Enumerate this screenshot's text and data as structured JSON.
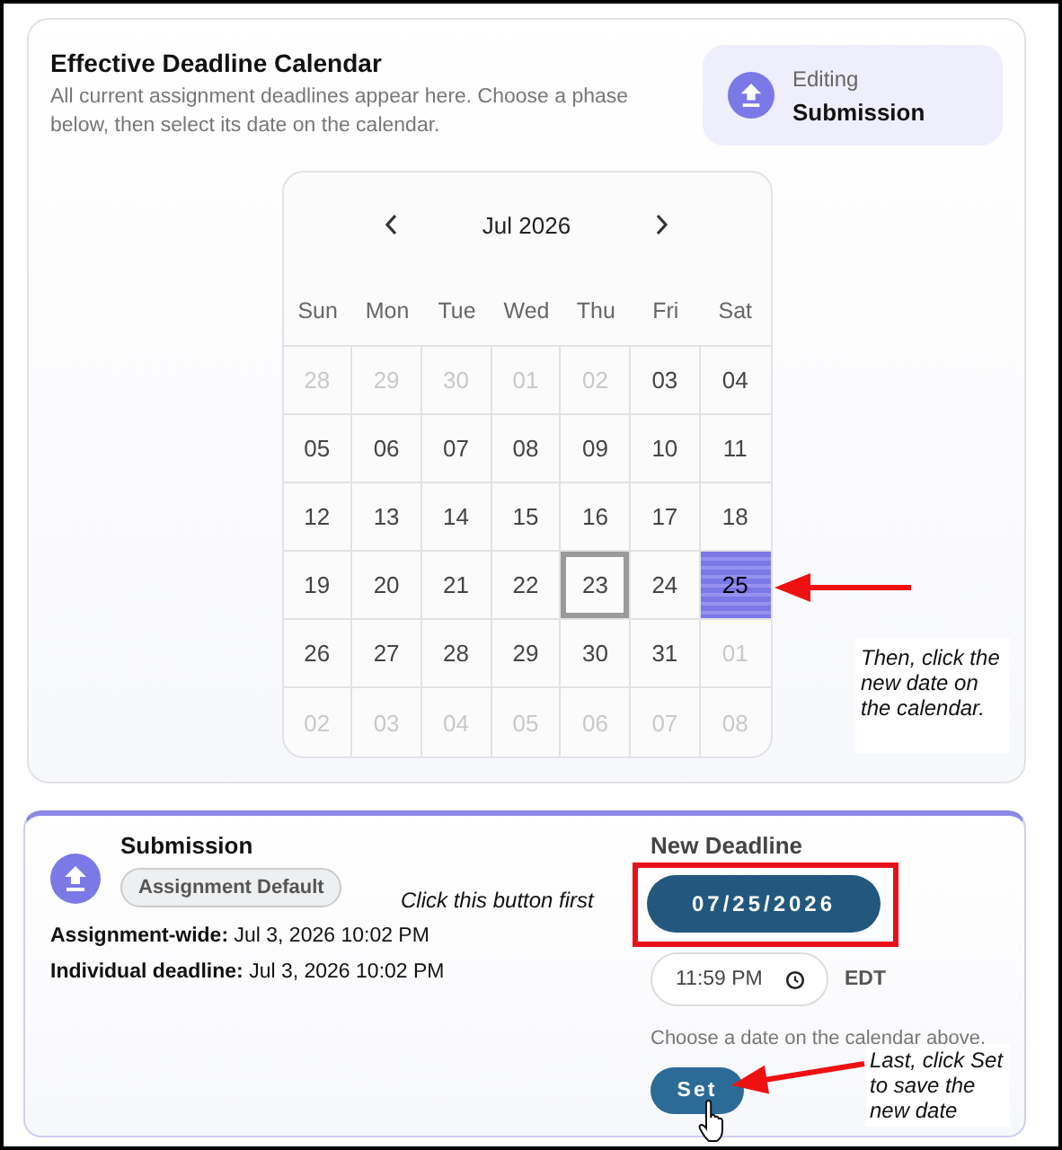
{
  "header": {
    "title": "Effective Deadline Calendar",
    "description": "All current assignment deadlines appear here. Choose a phase below, then select its date on the calendar."
  },
  "editing": {
    "label": "Editing",
    "phase": "Submission"
  },
  "calendar": {
    "month": "Jul 2026",
    "weekdays": [
      "Sun",
      "Mon",
      "Tue",
      "Wed",
      "Thu",
      "Fri",
      "Sat"
    ],
    "days": [
      {
        "day": "28",
        "outside": true,
        "selected": false,
        "today": false
      },
      {
        "day": "29",
        "outside": true,
        "selected": false,
        "today": false
      },
      {
        "day": "30",
        "outside": true,
        "selected": false,
        "today": false
      },
      {
        "day": "01",
        "outside": true,
        "selected": false,
        "today": false
      },
      {
        "day": "02",
        "outside": true,
        "selected": false,
        "today": false
      },
      {
        "day": "03",
        "outside": false,
        "selected": false,
        "today": false
      },
      {
        "day": "04",
        "outside": false,
        "selected": false,
        "today": false
      },
      {
        "day": "05",
        "outside": false,
        "selected": false,
        "today": false
      },
      {
        "day": "06",
        "outside": false,
        "selected": false,
        "today": false
      },
      {
        "day": "07",
        "outside": false,
        "selected": false,
        "today": false
      },
      {
        "day": "08",
        "outside": false,
        "selected": false,
        "today": false
      },
      {
        "day": "09",
        "outside": false,
        "selected": false,
        "today": false
      },
      {
        "day": "10",
        "outside": false,
        "selected": false,
        "today": false
      },
      {
        "day": "11",
        "outside": false,
        "selected": false,
        "today": false
      },
      {
        "day": "12",
        "outside": false,
        "selected": false,
        "today": false
      },
      {
        "day": "13",
        "outside": false,
        "selected": false,
        "today": false
      },
      {
        "day": "14",
        "outside": false,
        "selected": false,
        "today": false
      },
      {
        "day": "15",
        "outside": false,
        "selected": false,
        "today": false
      },
      {
        "day": "16",
        "outside": false,
        "selected": false,
        "today": false
      },
      {
        "day": "17",
        "outside": false,
        "selected": false,
        "today": false
      },
      {
        "day": "18",
        "outside": false,
        "selected": false,
        "today": false
      },
      {
        "day": "19",
        "outside": false,
        "selected": false,
        "today": false
      },
      {
        "day": "20",
        "outside": false,
        "selected": false,
        "today": false
      },
      {
        "day": "21",
        "outside": false,
        "selected": false,
        "today": false
      },
      {
        "day": "22",
        "outside": false,
        "selected": false,
        "today": false
      },
      {
        "day": "23",
        "outside": false,
        "selected": false,
        "today": true
      },
      {
        "day": "24",
        "outside": false,
        "selected": false,
        "today": false
      },
      {
        "day": "25",
        "outside": false,
        "selected": true,
        "today": false
      },
      {
        "day": "26",
        "outside": false,
        "selected": false,
        "today": false
      },
      {
        "day": "27",
        "outside": false,
        "selected": false,
        "today": false
      },
      {
        "day": "28",
        "outside": false,
        "selected": false,
        "today": false
      },
      {
        "day": "29",
        "outside": false,
        "selected": false,
        "today": false
      },
      {
        "day": "30",
        "outside": false,
        "selected": false,
        "today": false
      },
      {
        "day": "31",
        "outside": false,
        "selected": false,
        "today": false
      },
      {
        "day": "01",
        "outside": true,
        "selected": false,
        "today": false
      },
      {
        "day": "02",
        "outside": true,
        "selected": false,
        "today": false
      },
      {
        "day": "03",
        "outside": true,
        "selected": false,
        "today": false
      },
      {
        "day": "04",
        "outside": true,
        "selected": false,
        "today": false
      },
      {
        "day": "05",
        "outside": true,
        "selected": false,
        "today": false
      },
      {
        "day": "06",
        "outside": true,
        "selected": false,
        "today": false
      },
      {
        "day": "07",
        "outside": true,
        "selected": false,
        "today": false
      },
      {
        "day": "08",
        "outside": true,
        "selected": false,
        "today": false
      }
    ]
  },
  "phase": {
    "title": "Submission",
    "badge": "Assignment Default",
    "details": [
      {
        "label": "Assignment-wide:",
        "value": "Jul 3, 2026 10:02 PM"
      },
      {
        "label": "Individual deadline:",
        "value": "Jul 3, 2026 10:02 PM"
      }
    ]
  },
  "new_deadline": {
    "heading": "New Deadline",
    "date": "07/25/2026",
    "time": "11:59 PM",
    "timezone": "EDT",
    "hint": "Choose a date on the calendar above.",
    "set_button": "Set"
  },
  "annotations": [
    {
      "text": "Then, click the new date on the calendar."
    },
    {
      "text": "Click this button first"
    },
    {
      "text": "Last, click Set to save the new date"
    }
  ]
}
